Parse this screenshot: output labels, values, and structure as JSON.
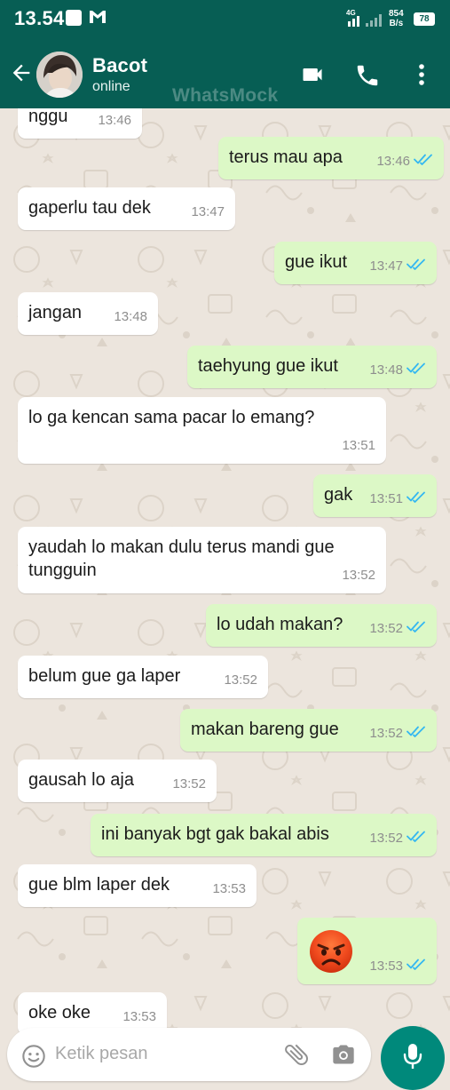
{
  "status_bar": {
    "time": "13.54",
    "network": "4G",
    "speed_value": "854",
    "speed_unit": "B/s",
    "battery": "78"
  },
  "header": {
    "contact_name": "Bacot",
    "contact_status": "online",
    "watermark": "WhatsMock"
  },
  "messages": [
    {
      "dir": "in",
      "text": "nggu",
      "time": "13:46"
    },
    {
      "dir": "out",
      "text": "terus mau apa",
      "time": "13:46"
    },
    {
      "dir": "in",
      "text": "gaperlu tau dek",
      "time": "13:47"
    },
    {
      "dir": "out",
      "text": "gue ikut",
      "time": "13:47"
    },
    {
      "dir": "in",
      "text": "jangan",
      "time": "13:48"
    },
    {
      "dir": "out",
      "text": "taehyung gue ikut",
      "time": "13:48"
    },
    {
      "dir": "in",
      "text": "lo ga kencan sama pacar lo emang?",
      "time": "13:51"
    },
    {
      "dir": "out",
      "text": "gak",
      "time": "13:51"
    },
    {
      "dir": "in",
      "text": "yaudah lo makan dulu terus mandi gue tungguin",
      "time": "13:52"
    },
    {
      "dir": "out",
      "text": "lo udah makan?",
      "time": "13:52"
    },
    {
      "dir": "in",
      "text": "belum gue ga laper",
      "time": "13:52"
    },
    {
      "dir": "out",
      "text": "makan bareng gue",
      "time": "13:52"
    },
    {
      "dir": "in",
      "text": "gausah lo aja",
      "time": "13:52"
    },
    {
      "dir": "out",
      "text": "ini banyak bgt gak bakal abis",
      "time": "13:52"
    },
    {
      "dir": "in",
      "text": "gue blm laper dek",
      "time": "13:53"
    },
    {
      "dir": "out",
      "text": "",
      "emoji": "angry-face",
      "time": "13:53"
    },
    {
      "dir": "in",
      "text": "oke oke",
      "time": "13:53"
    }
  ],
  "input": {
    "placeholder": "Ketik pesan"
  },
  "colors": {
    "header": "#075e54",
    "chat_background": "#ece5dd",
    "incoming_bubble": "#ffffff",
    "outgoing_bubble": "#dcf8c6",
    "read_ticks": "#34b7f1",
    "mic_button": "#00897b"
  },
  "icons": {
    "back": "arrow-left-icon",
    "video": "video-camera-icon",
    "call": "phone-icon",
    "menu": "more-vertical-icon",
    "emoji": "smiley-icon",
    "attach": "paperclip-icon",
    "camera": "camera-icon",
    "mic": "microphone-icon",
    "status_notification": "gmail-icon"
  }
}
